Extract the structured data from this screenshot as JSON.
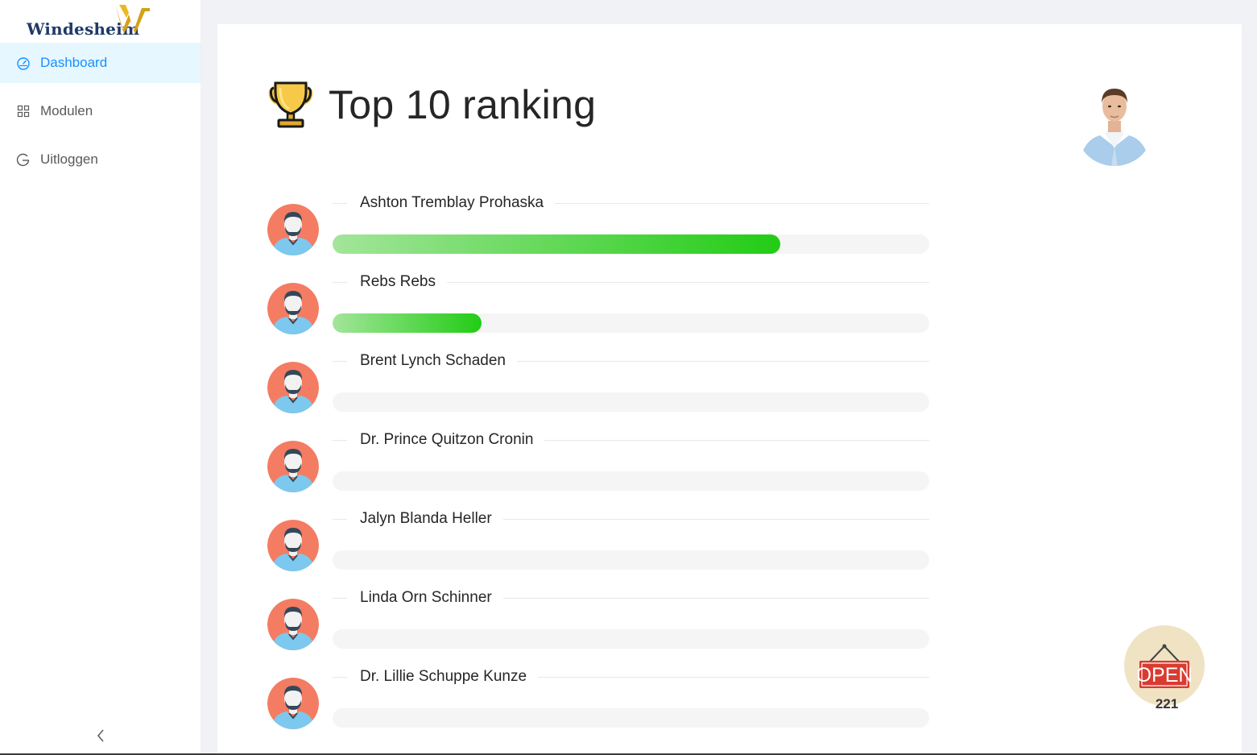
{
  "brand": {
    "name": "Windesheim",
    "accent": "#1890ff",
    "logo_text_color": "#1f3a68",
    "logo_mark_color": "#d4a017"
  },
  "sidebar": {
    "items": [
      {
        "label": "Dashboard",
        "icon": "dashboard-icon",
        "active": true
      },
      {
        "label": "Modulen",
        "icon": "appstore-icon",
        "active": false
      },
      {
        "label": "Uitloggen",
        "icon": "logout-icon",
        "active": false
      }
    ],
    "collapse_icon": "chevron-left-icon"
  },
  "page": {
    "title": "Top 10 ranking",
    "title_icon": "trophy-icon"
  },
  "ranking": [
    {
      "name": "Ashton Tremblay Prohaska",
      "progress_percent": 75
    },
    {
      "name": "Rebs Rebs",
      "progress_percent": 25
    },
    {
      "name": "Brent Lynch Schaden",
      "progress_percent": 0
    },
    {
      "name": "Dr. Prince Quitzon Cronin",
      "progress_percent": 0
    },
    {
      "name": "Jalyn Blanda Heller",
      "progress_percent": 0
    },
    {
      "name": "Linda Orn Schinner",
      "progress_percent": 0
    },
    {
      "name": "Dr. Lillie Schuppe Kunze",
      "progress_percent": 0
    }
  ],
  "open_badge": {
    "label": "OPEN",
    "count": "221"
  },
  "colors": {
    "progress_start": "#a3e59a",
    "progress_end": "#22cc15",
    "track": "#f5f5f5",
    "avatar_bg": "#f47c62"
  }
}
